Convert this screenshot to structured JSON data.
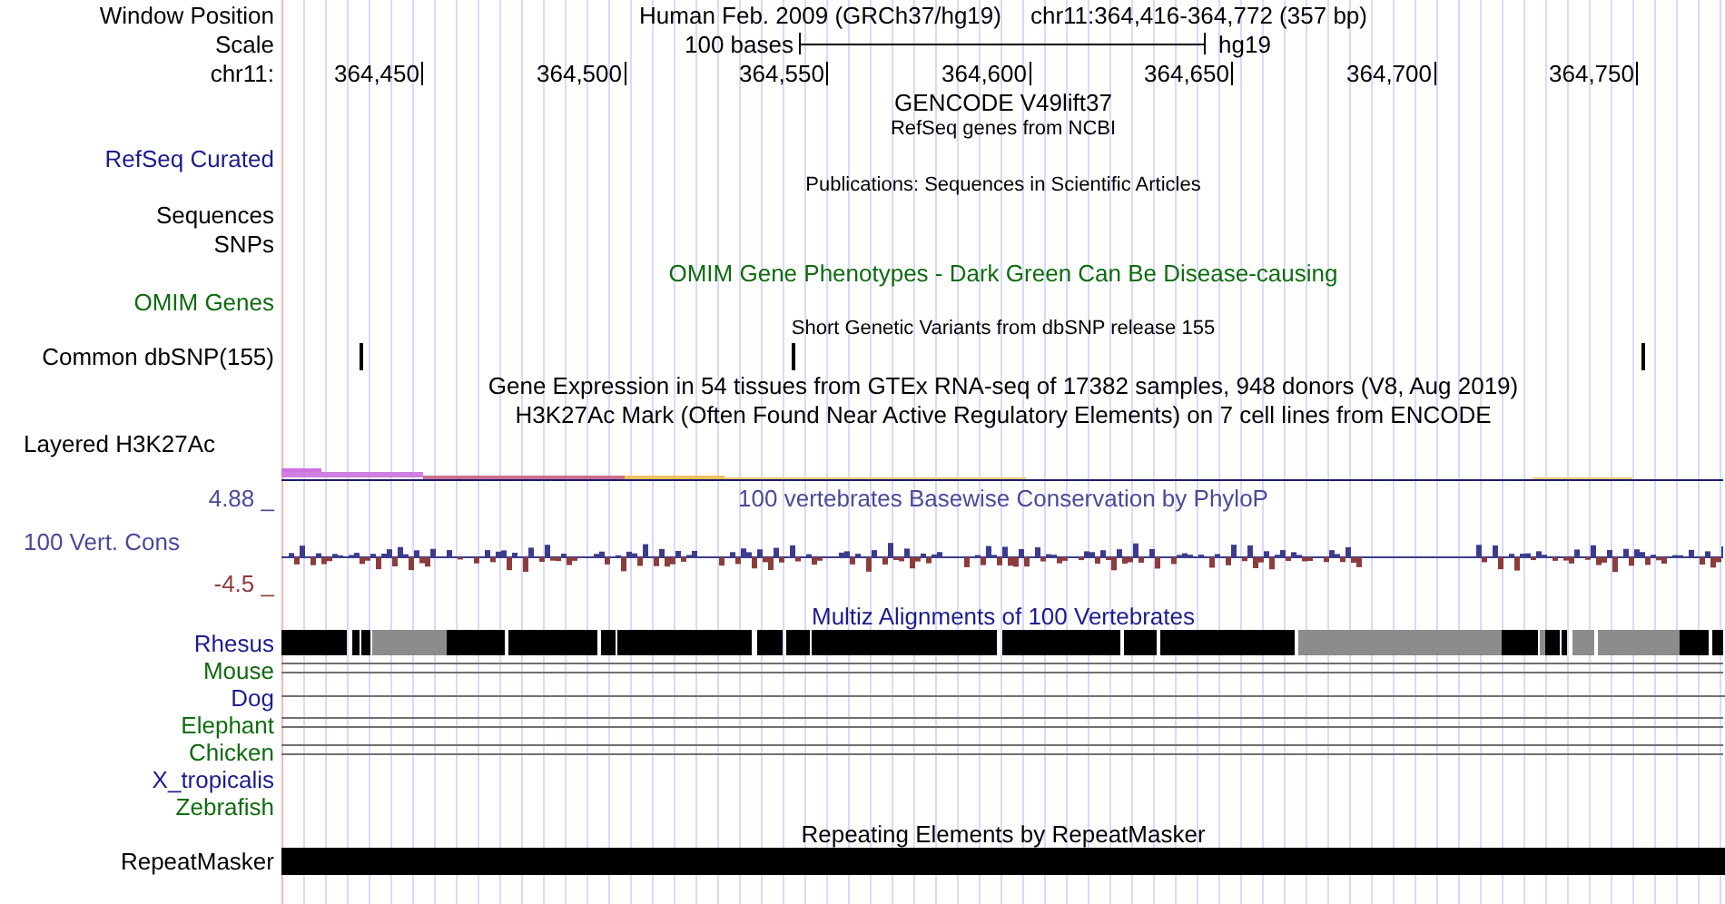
{
  "header": {
    "label": "Window Position",
    "assembly": "Human Feb. 2009 (GRCh37/hg19)",
    "position": "chr11:364,416-364,772 (357 bp)"
  },
  "scale": {
    "label": "Scale",
    "length": "100 bases",
    "assembly": "hg19"
  },
  "ruler": {
    "label": "chr11:",
    "ticks": [
      "364,450",
      "364,500",
      "364,550",
      "364,600",
      "364,650",
      "364,700",
      "364,750"
    ]
  },
  "tracks": [
    {
      "kind": "title",
      "text": "GENCODE V49lift37",
      "color": "#000000"
    },
    {
      "kind": "subtitle",
      "text": "RefSeq genes from NCBI"
    },
    {
      "kind": "label",
      "label": "RefSeq Curated",
      "color": "#1c1c8c"
    },
    {
      "kind": "subtitle",
      "text": "Publications: Sequences in Scientific Articles"
    },
    {
      "kind": "label",
      "label": "Sequences",
      "color": "#000000"
    },
    {
      "kind": "label",
      "label": "SNPs",
      "color": "#000000"
    },
    {
      "kind": "title",
      "text": "OMIM Gene Phenotypes - Dark Green Can Be Disease-causing",
      "color": "#0f6b0f"
    },
    {
      "kind": "label",
      "label": "OMIM Genes",
      "color": "#0f6b0f"
    },
    {
      "kind": "subtitle",
      "text": "Short Genetic Variants from dbSNP release 155"
    },
    {
      "kind": "snp",
      "label": "Common dbSNP(155)",
      "color": "#000000"
    },
    {
      "kind": "title",
      "text": "Gene Expression in 54 tissues from GTEx RNA-seq of 17382 samples, 948 donors (V8, Aug 2019)",
      "color": "#000000"
    },
    {
      "kind": "title",
      "text": "H3K27Ac Mark (Often Found Near Active Regulatory Elements) on 7 cell lines from ENCODE",
      "color": "#000000"
    },
    {
      "kind": "group",
      "label": "Layered H3K27Ac",
      "color": "#000000"
    },
    {
      "kind": "signal"
    }
  ],
  "conservation": {
    "max": "4.88 _",
    "title": "100 vertebrates Basewise Conservation by PhyloP",
    "label": "100 Vert. Cons",
    "min": "-4.5 _"
  },
  "multiz": {
    "title": "Multiz Alignments of 100 Vertebrates",
    "species": [
      {
        "name": "Rhesus",
        "color": "#1c1c8c",
        "kind": "bar"
      },
      {
        "name": "Mouse",
        "color": "#0f6b0f",
        "kind": "double"
      },
      {
        "name": "Dog",
        "color": "#1c1c8c",
        "kind": "single"
      },
      {
        "name": "Elephant",
        "color": "#0f6b0f",
        "kind": "double"
      },
      {
        "name": "Chicken",
        "color": "#0f6b0f",
        "kind": "double"
      },
      {
        "name": "X_tropicalis",
        "color": "#1c1c8c",
        "kind": "none"
      },
      {
        "name": "Zebrafish",
        "color": "#0f6b0f",
        "kind": "none"
      }
    ]
  },
  "repeats": {
    "title": "Repeating Elements by RepeatMasker",
    "label": "RepeatMasker"
  }
}
